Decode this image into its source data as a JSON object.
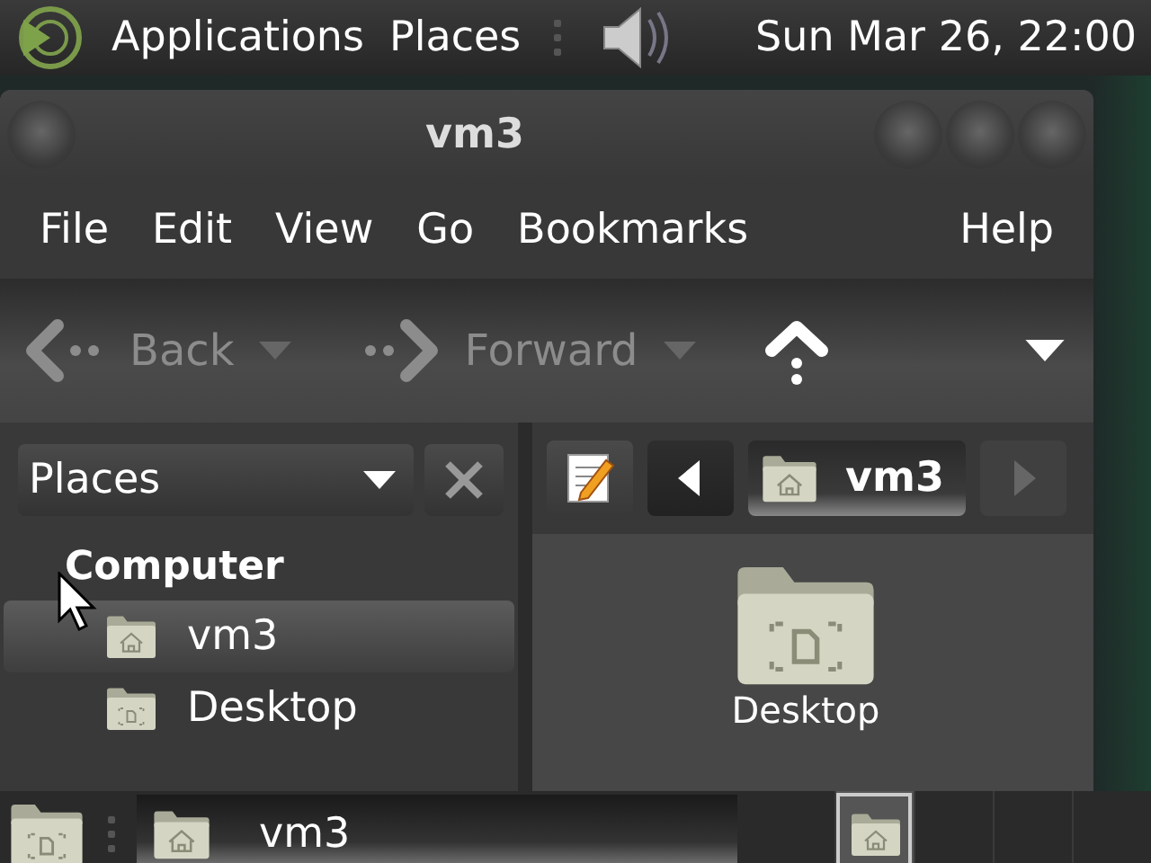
{
  "top_panel": {
    "menus": [
      "Applications",
      "Places"
    ],
    "clock": "Sun Mar 26, 22:00"
  },
  "window": {
    "title": "vm3",
    "menu": [
      "File",
      "Edit",
      "View",
      "Go",
      "Bookmarks",
      "Help"
    ],
    "toolbar": {
      "back": {
        "label": "Back",
        "disabled": true
      },
      "forward": {
        "label": "Forward",
        "disabled": true
      }
    },
    "sidebar": {
      "selector": "Places",
      "heading": "Computer",
      "items": [
        {
          "label": "vm3",
          "kind": "home",
          "selected": true
        },
        {
          "label": "Desktop",
          "kind": "desktop",
          "selected": false
        }
      ]
    },
    "path_bar": {
      "segments": [
        {
          "label": "vm3",
          "kind": "home",
          "selected": true
        }
      ]
    },
    "files": [
      {
        "label": "Desktop",
        "kind": "desktop"
      }
    ]
  },
  "taskbar": {
    "tasks": [
      {
        "label": "vm3",
        "kind": "home",
        "selected": true
      }
    ],
    "workspaces": [
      {
        "selected": true
      },
      {
        "selected": false
      },
      {
        "selected": false
      },
      {
        "selected": false
      }
    ]
  }
}
